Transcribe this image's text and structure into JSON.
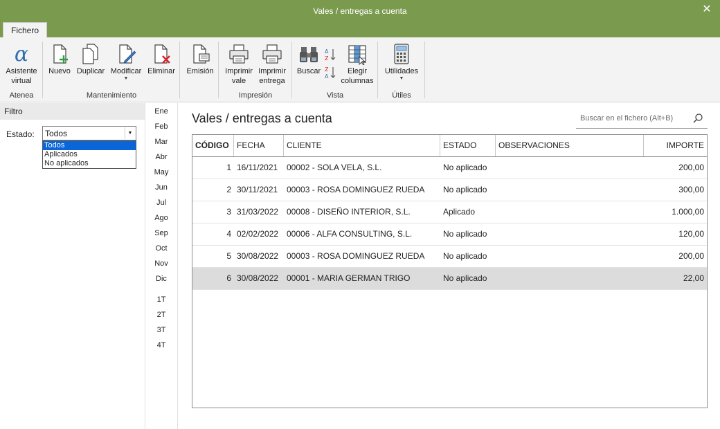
{
  "window": {
    "title": "Vales / entregas a cuenta",
    "close_glyph": "✕"
  },
  "tabs": [
    {
      "label": "Fichero"
    }
  ],
  "ribbon": {
    "groups": [
      {
        "label": "Atenea"
      },
      {
        "label": "Mantenimiento"
      },
      {
        "label": "Impresión"
      },
      {
        "label": "Vista"
      },
      {
        "label": "Útiles"
      }
    ],
    "buttons": {
      "asistente": {
        "line1": "Asistente",
        "line2": "virtual",
        "icon": "alpha-icon"
      },
      "nuevo": {
        "line1": "Nuevo",
        "icon": "new-document-icon"
      },
      "duplicar": {
        "line1": "Duplicar",
        "icon": "duplicate-icon"
      },
      "modificar": {
        "line1": "Modificar",
        "icon": "edit-document-icon"
      },
      "eliminar": {
        "line1": "Eliminar",
        "icon": "delete-document-icon"
      },
      "emision": {
        "line1": "Emisión",
        "icon": "emission-icon"
      },
      "imprimir_vale": {
        "line1": "Imprimir",
        "line2": "vale",
        "icon": "printer-icon"
      },
      "imprimir_entrega": {
        "line1": "Imprimir",
        "line2": "entrega",
        "icon": "printer-icon"
      },
      "buscar": {
        "line1": "Buscar",
        "icon": "binoculars-icon"
      },
      "sort_az": {
        "line1": "AZ",
        "icon": "sort-ascending-icon"
      },
      "sort_za": {
        "line1": "ZA",
        "icon": "sort-descending-icon"
      },
      "elegir": {
        "line1": "Elegir",
        "line2": "columnas",
        "icon": "columns-icon"
      },
      "utilidades": {
        "line1": "Utilidades",
        "icon": "calculator-icon"
      }
    }
  },
  "filter": {
    "title": "Filtro",
    "estado_label": "Estado:",
    "estado_value": "Todos",
    "options": [
      "Todos",
      "Aplicados",
      "No aplicados"
    ]
  },
  "months": [
    "Ene",
    "Feb",
    "Mar",
    "Abr",
    "May",
    "Jun",
    "Jul",
    "Ago",
    "Sep",
    "Oct",
    "Nov",
    "Dic"
  ],
  "quarters": [
    "1T",
    "2T",
    "3T",
    "4T"
  ],
  "main": {
    "title": "Vales / entregas a cuenta",
    "search_placeholder": "Buscar en el fichero (Alt+B)"
  },
  "table": {
    "columns": [
      "CÓDIGO",
      "FECHA",
      "CLIENTE",
      "ESTADO",
      "OBSERVACIONES",
      "IMPORTE"
    ],
    "rows": [
      {
        "codigo": "1",
        "fecha": "16/11/2021",
        "cliente": "00002 - SOLA VELA, S.L.",
        "estado": "No aplicado",
        "observaciones": "",
        "importe": "200,00"
      },
      {
        "codigo": "2",
        "fecha": "30/11/2021",
        "cliente": "00003 - ROSA DOMINGUEZ RUEDA",
        "estado": "No aplicado",
        "observaciones": "",
        "importe": "300,00"
      },
      {
        "codigo": "3",
        "fecha": "31/03/2022",
        "cliente": "00008 - DISEÑO INTERIOR, S.L.",
        "estado": "Aplicado",
        "observaciones": "",
        "importe": "1.000,00"
      },
      {
        "codigo": "4",
        "fecha": "02/02/2022",
        "cliente": "00006 - ALFA CONSULTING, S.L.",
        "estado": "No aplicado",
        "observaciones": "",
        "importe": "120,00"
      },
      {
        "codigo": "5",
        "fecha": "30/08/2022",
        "cliente": "00003 - ROSA DOMINGUEZ RUEDA",
        "estado": "No aplicado",
        "observaciones": "",
        "importe": "200,00"
      },
      {
        "codigo": "6",
        "fecha": "30/08/2022",
        "cliente": "00001 - MARIA GERMAN TRIGO",
        "estado": "No aplicado",
        "observaciones": "",
        "importe": "22,00"
      }
    ],
    "selected_row": 5
  },
  "colors": {
    "titlebar": "#7a9a4e",
    "selection": "#0a66d8",
    "row_selected": "#dcdcdc",
    "delete_red": "#d9262c",
    "new_green": "#2e9e3e"
  }
}
